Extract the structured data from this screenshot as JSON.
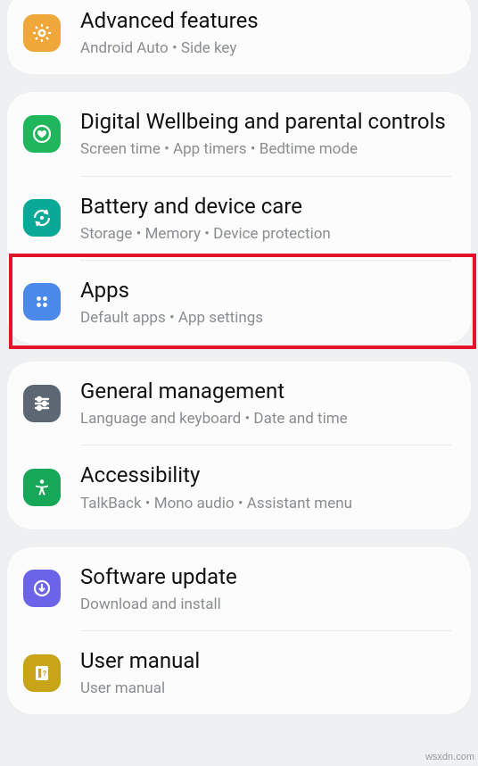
{
  "groups": [
    {
      "items": [
        {
          "icon": "gear-plus",
          "bg": "#f0a73a",
          "title": "Advanced features",
          "subtitle": "Android Auto  •  Side key"
        }
      ]
    },
    {
      "items": [
        {
          "icon": "heart-circle",
          "bg": "#20b75c",
          "title": "Digital Wellbeing and parental controls",
          "subtitle": "Screen time  •  App timers  •  Bedtime mode"
        },
        {
          "icon": "refresh-dot",
          "bg": "#0aa896",
          "title": "Battery and device care",
          "subtitle": "Storage  •  Memory  •  Device protection"
        },
        {
          "icon": "four-dots",
          "bg": "#4a88ea",
          "title": "Apps",
          "subtitle": "Default apps  •  App settings",
          "highlighted": true
        }
      ]
    },
    {
      "items": [
        {
          "icon": "sliders",
          "bg": "#5d6773",
          "title": "General management",
          "subtitle": "Language and keyboard  •  Date and time"
        },
        {
          "icon": "person-arms",
          "bg": "#16a858",
          "title": "Accessibility",
          "subtitle": "TalkBack  •  Mono audio  •  Assistant menu"
        }
      ]
    },
    {
      "items": [
        {
          "icon": "download-circle",
          "bg": "#6b63e8",
          "title": "Software update",
          "subtitle": "Download and install"
        },
        {
          "icon": "manual",
          "bg": "#c9a318",
          "title": "User manual",
          "subtitle": "User manual"
        }
      ]
    }
  ],
  "watermark": "wsxdn.com"
}
